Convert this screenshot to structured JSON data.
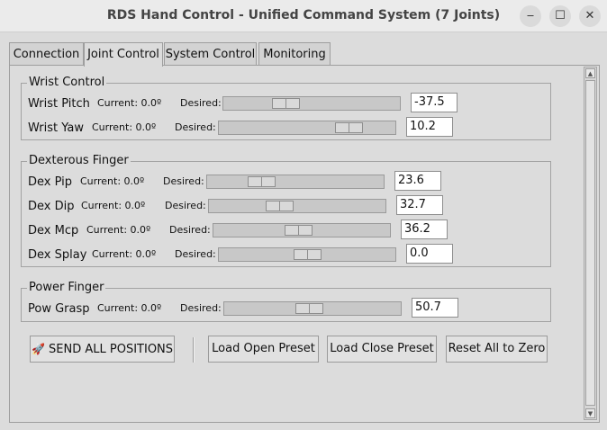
{
  "window": {
    "title": "RDS Hand Control - Unified Command System (7 Joints)"
  },
  "window_controls": {
    "minimize": "‒",
    "maximize": "☐",
    "close": "✕"
  },
  "tabs": [
    {
      "label": "Connection"
    },
    {
      "label": "Joint Control",
      "active": true
    },
    {
      "label": "System Control"
    },
    {
      "label": "Monitoring"
    }
  ],
  "groups": {
    "wrist": {
      "title": "Wrist Control",
      "joints": [
        {
          "name": "Wrist Pitch",
          "current": "Current: 0.0º",
          "desired_label": "Desired:",
          "value": "-37.5",
          "slider_fraction": 0.33
        },
        {
          "name": "Wrist Yaw",
          "current": "Current: 0.0º",
          "desired_label": "Desired:",
          "value": "10.2",
          "slider_fraction": 0.78
        }
      ]
    },
    "dex": {
      "title": "Dexterous Finger",
      "joints": [
        {
          "name": "Dex Pip",
          "current": "Current: 0.0º",
          "desired_label": "Desired:",
          "value": "23.6",
          "slider_fraction": 0.27
        },
        {
          "name": "Dex Dip",
          "current": "Current: 0.0º",
          "desired_label": "Desired:",
          "value": "32.7",
          "slider_fraction": 0.38
        },
        {
          "name": "Dex Mcp",
          "current": "Current: 0.0º",
          "desired_label": "Desired:",
          "value": "36.2",
          "slider_fraction": 0.48
        },
        {
          "name": "Dex Splay",
          "current": "Current: 0.0º",
          "desired_label": "Desired:",
          "value": "0.0",
          "slider_fraction": 0.5
        }
      ]
    },
    "power": {
      "title": "Power Finger",
      "joints": [
        {
          "name": "Pow Grasp",
          "current": "Current: 0.0º",
          "desired_label": "Desired:",
          "value": "50.7",
          "slider_fraction": 0.48
        }
      ]
    }
  },
  "buttons": {
    "send_icon": "🚀",
    "send": "SEND ALL POSITIONS",
    "load_open": "Load Open Preset",
    "load_close": "Load Close Preset",
    "reset": "Reset All to Zero"
  }
}
